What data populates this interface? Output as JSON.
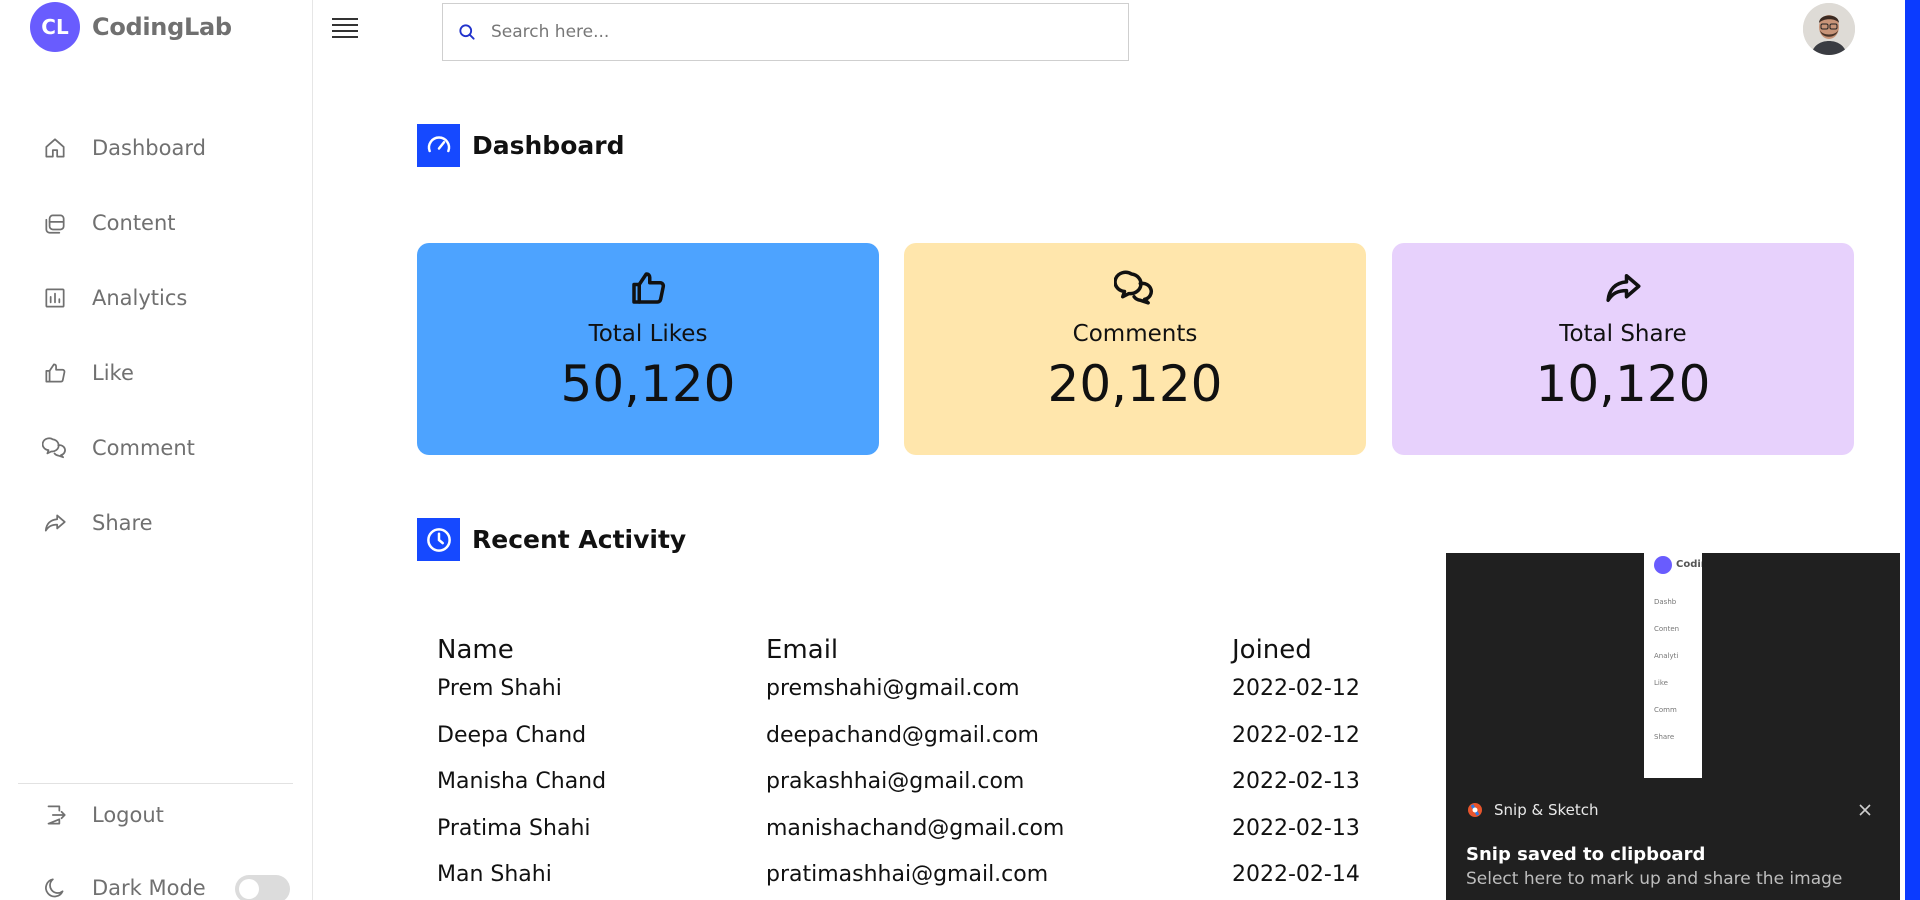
{
  "brand": {
    "badge": "CL",
    "name": "CodingLab"
  },
  "sidebar": {
    "items": [
      {
        "label": "Dashboard",
        "icon": "home-icon"
      },
      {
        "label": "Content",
        "icon": "files-icon"
      },
      {
        "label": "Analytics",
        "icon": "chart-icon"
      },
      {
        "label": "Like",
        "icon": "thumbs-up-icon"
      },
      {
        "label": "Comment",
        "icon": "comments-icon"
      },
      {
        "label": "Share",
        "icon": "share-icon"
      }
    ],
    "logout_label": "Logout",
    "dark_mode_label": "Dark Mode",
    "dark_mode_on": false
  },
  "search": {
    "placeholder": "Search here..."
  },
  "dashboard": {
    "title": "Dashboard",
    "cards": [
      {
        "label": "Total Likes",
        "value": "50,120",
        "color": "#4da3ff",
        "icon": "thumbs-up-icon"
      },
      {
        "label": "Comments",
        "value": "20,120",
        "color": "#ffe6ac",
        "icon": "comments-icon"
      },
      {
        "label": "Total Share",
        "value": "10,120",
        "color": "#e7d1fc",
        "icon": "share-icon"
      }
    ]
  },
  "activity": {
    "title": "Recent Activity",
    "columns": [
      "Name",
      "Email",
      "Joined"
    ],
    "rows": [
      [
        "Prem Shahi",
        "premshahi@gmail.com",
        "2022-02-12"
      ],
      [
        "Deepa Chand",
        "deepachand@gmail.com",
        "2022-02-12"
      ],
      [
        "Manisha Chand",
        "prakashhai@gmail.com",
        "2022-02-13"
      ],
      [
        "Pratima Shahi",
        "manishachand@gmail.com",
        "2022-02-13"
      ],
      [
        "Man Shahi",
        "pratimashhai@gmail.com",
        "2022-02-14"
      ]
    ]
  },
  "notification": {
    "app_name": "Snip & Sketch",
    "title": "Snip saved to clipboard",
    "body": "Select here to mark up and share the image",
    "thumb_logo": "Codin",
    "thumb_items": [
      "Dashb",
      "Conten",
      "Analyti",
      "Like",
      "Comm",
      "Share"
    ]
  },
  "colors": {
    "accent": "#1649ff",
    "brand": "#695CFE",
    "edge": "#0b3bff"
  }
}
